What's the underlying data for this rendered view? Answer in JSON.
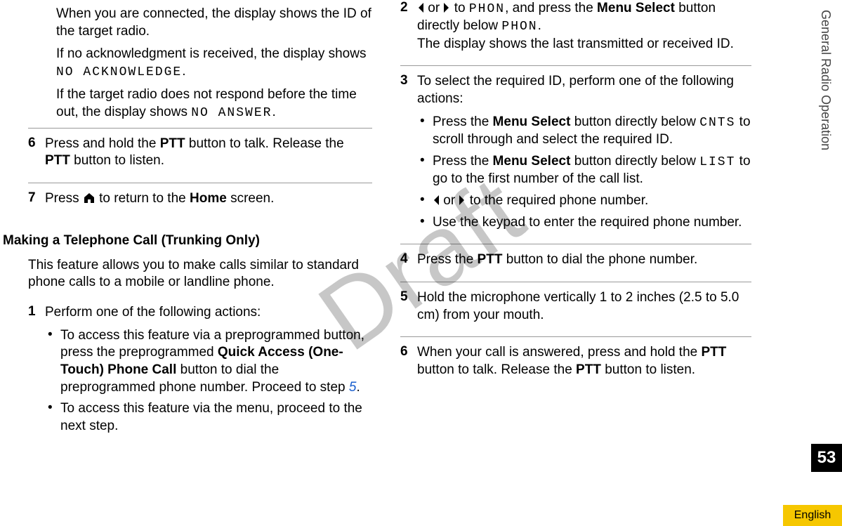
{
  "sideHeader": "General Radio Operation",
  "pageNumber": "53",
  "language": "English",
  "watermark": "Draft",
  "colA": {
    "p1a": "When you are connected, the display shows the ID of the target radio.",
    "p1b_pre": "If no acknowledgment is received, the display shows ",
    "p1b_code": "NO ACKNOWLEDGE",
    "p1b_post": ".",
    "p1c_pre": "If the target radio does not respond before the time out, the display shows ",
    "p1c_code": "NO ANSWER",
    "p1c_post": ".",
    "step6_num": "6",
    "step6_a": "Press and hold the ",
    "step6_b": "PTT",
    "step6_c": " button to talk. Release the ",
    "step6_d": "PTT",
    "step6_e": " button to listen.",
    "step7_num": "7",
    "step7_a": "Press ",
    "step7_b": " to return to the ",
    "step7_c": "Home",
    "step7_d": " screen.",
    "heading": "Making a Telephone Call (Trunking Only)",
    "desc": "This feature allows you to make calls similar to standard phone calls to a mobile or landline phone.",
    "step1_num": "1",
    "step1_lead": "Perform one of the following actions:",
    "step1_b1_a": "To access this feature via a preprogrammed button, press the preprogrammed ",
    "step1_b1_b": "Quick Access (One-Touch) Phone Call",
    "step1_b1_c": " button to dial the preprogrammed phone number. Proceed to step ",
    "step1_b1_link": "5",
    "step1_b1_d": ".",
    "step1_b2": "To access this feature via the menu, proceed to the next step."
  },
  "colB": {
    "step2_num": "2",
    "step2_a": " or ",
    "step2_b": " to ",
    "step2_c": "PHON",
    "step2_d": ", and press the ",
    "step2_e": "Menu Select",
    "step2_f": " button directly below ",
    "step2_g": "PHON",
    "step2_h": ".",
    "step2_i": "The display shows the last transmitted or received ID.",
    "step3_num": "3",
    "step3_lead": "To select the required ID, perform one of the following actions:",
    "step3_b1_a": "Press the ",
    "step3_b1_b": "Menu Select",
    "step3_b1_c": " button directly below ",
    "step3_b1_d": "CNTS",
    "step3_b1_e": " to scroll through and select the required ID.",
    "step3_b2_a": "Press the ",
    "step3_b2_b": "Menu Select",
    "step3_b2_c": " button directly below ",
    "step3_b2_d": "LIST",
    "step3_b2_e": " to go to the first number of the call list.",
    "step3_b3_a": " or ",
    "step3_b3_b": " to the required phone number.",
    "step3_b4": "Use the keypad to enter the required phone number.",
    "step4_num": "4",
    "step4_a": "Press the ",
    "step4_b": "PTT",
    "step4_c": " button to dial the phone number.",
    "step5_num": "5",
    "step5": "Hold the microphone vertically 1 to 2 inches (2.5 to 5.0 cm) from your mouth.",
    "step6_num": "6",
    "step6_a": "When your call is answered, press and hold the ",
    "step6_b": "PTT",
    "step6_c": " button to talk. Release the ",
    "step6_d": "PTT",
    "step6_e": " button to listen."
  }
}
